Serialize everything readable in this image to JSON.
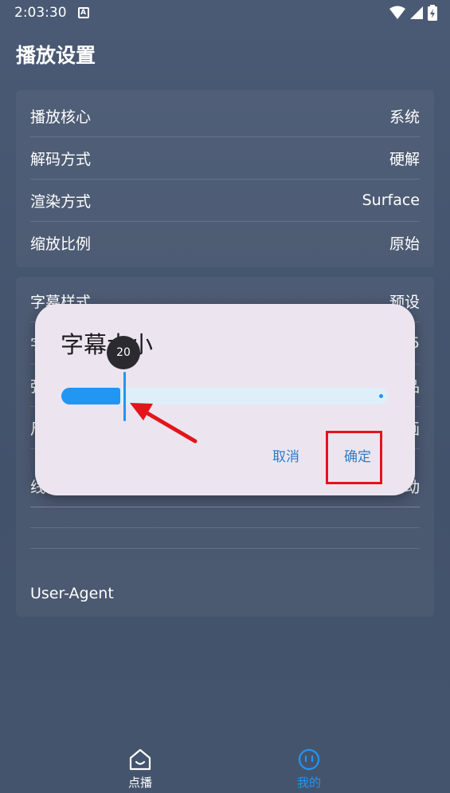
{
  "status_bar": {
    "time": "2:03:30",
    "notification_glyph": "A"
  },
  "page": {
    "title": "播放设置"
  },
  "group1": [
    {
      "label": "播放核心",
      "value": "系统"
    },
    {
      "label": "解码方式",
      "value": "硬解"
    },
    {
      "label": "渲染方式",
      "value": "Surface"
    },
    {
      "label": "缩放比例",
      "value": "原始"
    }
  ],
  "group2": [
    {
      "label": "字幕样式",
      "value": "预设"
    },
    {
      "label": "字",
      "value": "5"
    },
    {
      "label": "弹",
      "value": "品"
    },
    {
      "label": "尺",
      "value": "画"
    },
    {
      "label": "线",
      "value": "动"
    },
    {
      "label": "",
      "value": ""
    },
    {
      "label": "",
      "value": ""
    },
    {
      "label": "",
      "value": ""
    },
    {
      "label": "User-Agent",
      "value": ""
    }
  ],
  "dialog": {
    "title": "字幕大小",
    "slider_value": "20",
    "slider_fraction": 0.19,
    "cancel_label": "取消",
    "ok_label": "确定"
  },
  "bottom_nav": [
    {
      "label": "点播",
      "icon": "home-icon"
    },
    {
      "label": "我的",
      "icon": "smiley-icon"
    }
  ],
  "colors": {
    "accent": "#2196f3",
    "annotation": "#e3141b"
  }
}
